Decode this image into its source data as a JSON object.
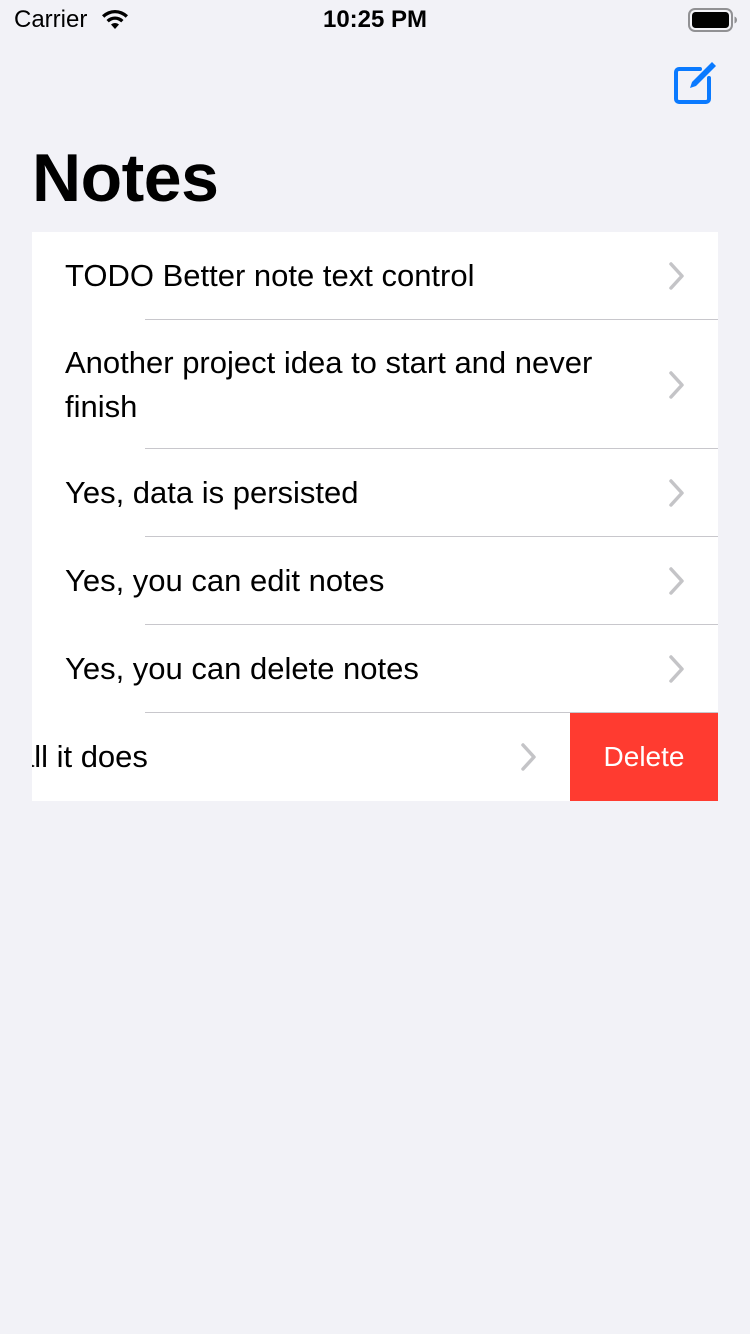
{
  "status_bar": {
    "carrier": "Carrier",
    "time": "10:25 PM",
    "wifi_icon": "wifi-icon",
    "battery_icon": "battery-icon"
  },
  "nav": {
    "compose_icon": "compose-icon",
    "title": "Notes"
  },
  "colors": {
    "accent": "#0a7aff",
    "background": "#f2f2f7",
    "delete": "#ff3b30",
    "separator": "#c8c7cc",
    "chevron": "#c4c4c7"
  },
  "notes": [
    {
      "text": "TODO Better note text control"
    },
    {
      "text": "Another project idea to start and never finish"
    },
    {
      "text": "Yes, data is persisted"
    },
    {
      "text": "Yes, you can edit notes"
    },
    {
      "text": "Yes, you can delete notes"
    },
    {
      "text": "kind of all it does"
    }
  ],
  "swipe_action": {
    "delete_label": "Delete"
  }
}
